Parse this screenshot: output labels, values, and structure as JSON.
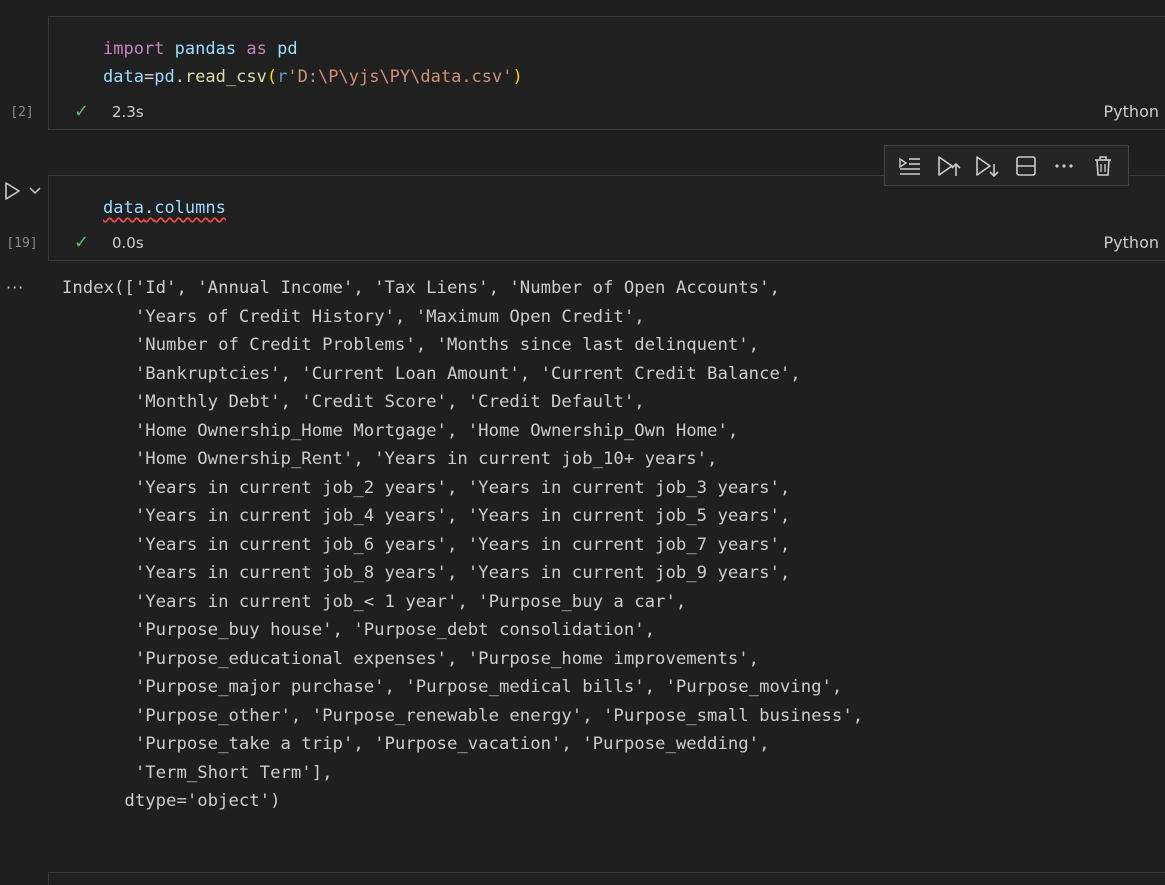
{
  "cells": [
    {
      "exec_count": "[2]",
      "code_lines": [
        {
          "tokens": [
            {
              "t": "import",
              "c": "kw"
            },
            {
              "t": " ",
              "c": ""
            },
            {
              "t": "pandas",
              "c": "id"
            },
            {
              "t": " ",
              "c": ""
            },
            {
              "t": "as",
              "c": "kw"
            },
            {
              "t": " ",
              "c": ""
            },
            {
              "t": "pd",
              "c": "id"
            }
          ]
        },
        {
          "tokens": [
            {
              "t": "data",
              "c": "id"
            },
            {
              "t": "=",
              "c": ""
            },
            {
              "t": "pd",
              "c": "id"
            },
            {
              "t": ".",
              "c": ""
            },
            {
              "t": "read_csv",
              "c": "fn"
            },
            {
              "t": "(",
              "c": "paren"
            },
            {
              "t": "r",
              "c": "rprefix"
            },
            {
              "t": "'D:\\P\\yjs\\PY\\data.csv'",
              "c": "str"
            },
            {
              "t": ")",
              "c": "paren"
            }
          ]
        }
      ],
      "status_icon": "check-icon",
      "duration": "2.3s",
      "language": "Python"
    },
    {
      "exec_count": "[19]",
      "code_lines": [
        {
          "tokens": [
            {
              "t": "data",
              "c": "id squiggle"
            },
            {
              "t": ".",
              "c": "squiggle"
            },
            {
              "t": "columns",
              "c": "id squiggle"
            }
          ]
        }
      ],
      "status_icon": "check-icon",
      "duration": "0.0s",
      "language": "Python"
    }
  ],
  "cell_toolbar": [
    {
      "name": "run-by-line-button",
      "icon": "run-by-line-icon"
    },
    {
      "name": "execute-above-button",
      "icon": "execute-above-icon"
    },
    {
      "name": "execute-below-button",
      "icon": "execute-below-icon"
    },
    {
      "name": "split-cell-button",
      "icon": "split-cell-icon"
    },
    {
      "name": "more-actions-button",
      "icon": "ellipsis-icon"
    },
    {
      "name": "delete-cell-button",
      "icon": "trash-icon"
    }
  ],
  "output_menu": "···",
  "output_lines": [
    "Index(['Id', 'Annual Income', 'Tax Liens', 'Number of Open Accounts',",
    "       'Years of Credit History', 'Maximum Open Credit',",
    "       'Number of Credit Problems', 'Months since last delinquent',",
    "       'Bankruptcies', 'Current Loan Amount', 'Current Credit Balance',",
    "       'Monthly Debt', 'Credit Score', 'Credit Default',",
    "       'Home Ownership_Home Mortgage', 'Home Ownership_Own Home',",
    "       'Home Ownership_Rent', 'Years in current job_10+ years',",
    "       'Years in current job_2 years', 'Years in current job_3 years',",
    "       'Years in current job_4 years', 'Years in current job_5 years',",
    "       'Years in current job_6 years', 'Years in current job_7 years',",
    "       'Years in current job_8 years', 'Years in current job_9 years',",
    "       'Years in current job_< 1 year', 'Purpose_buy a car',",
    "       'Purpose_buy house', 'Purpose_debt consolidation',",
    "       'Purpose_educational expenses', 'Purpose_home improvements',",
    "       'Purpose_major purchase', 'Purpose_medical bills', 'Purpose_moving',",
    "       'Purpose_other', 'Purpose_renewable energy', 'Purpose_small business',",
    "       'Purpose_take a trip', 'Purpose_vacation', 'Purpose_wedding',",
    "       'Term_Short Term'],",
    "      dtype='object')"
  ],
  "colors": {
    "background": "#1f1f1f",
    "keyword": "#c586c0",
    "identifier": "#9cdcfe",
    "function": "#dcdcaa",
    "string": "#ce9178",
    "success": "#4ec26f",
    "error_squiggle": "#f14c4c"
  }
}
